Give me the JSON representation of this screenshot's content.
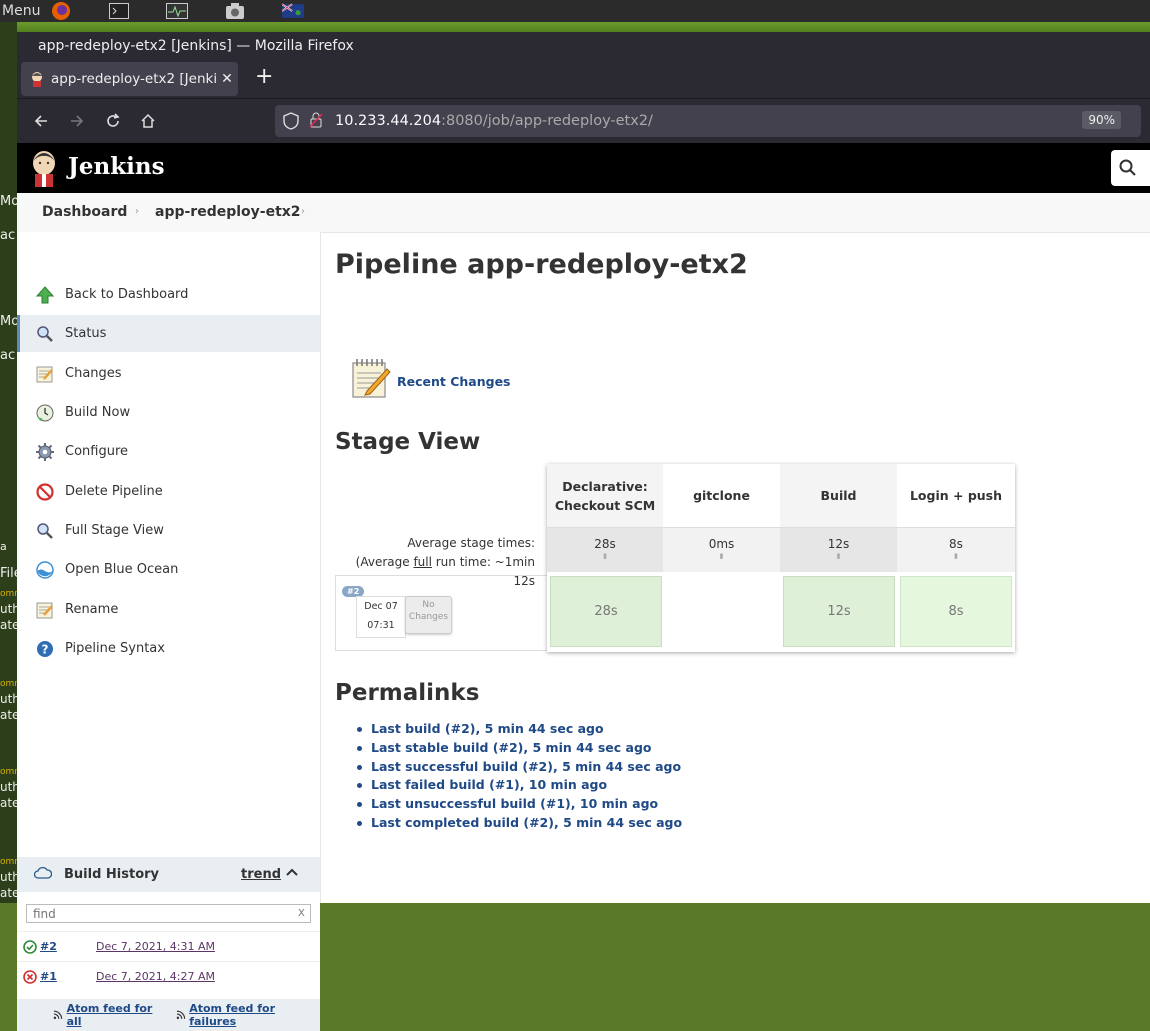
{
  "os_panel": {
    "menu_label": "Menu"
  },
  "desktop_fragments": [
    "Mo",
    "ac",
    "Mo",
    "ac",
    "a",
    "File",
    "omm",
    "uth",
    "ate",
    "omm",
    "uth",
    "ate",
    "omm",
    "uth",
    "ate",
    "omm",
    "uth",
    "ate"
  ],
  "window": {
    "title": "app-redeploy-etx2 [Jenkins] — Mozilla Firefox"
  },
  "tab": {
    "title": "app-redeploy-etx2 [Jenki",
    "close": "✕"
  },
  "newtab": "+",
  "nav": {
    "url_host": "10.233.44.204",
    "url_rest": ":8080/job/app-redeploy-etx2/",
    "zoom": "90%"
  },
  "jenkins": {
    "title": "Jenkins"
  },
  "breadcrumb": {
    "dashboard": "Dashboard",
    "job": "app-redeploy-etx2",
    "sep": "›"
  },
  "sidebar": {
    "items": [
      {
        "label": "Back to Dashboard",
        "icon": "up-arrow-icon"
      },
      {
        "label": "Status",
        "icon": "search-icon"
      },
      {
        "label": "Changes",
        "icon": "notepad-icon"
      },
      {
        "label": "Build Now",
        "icon": "clock-icon"
      },
      {
        "label": "Configure",
        "icon": "gear-icon"
      },
      {
        "label": "Delete Pipeline",
        "icon": "no-entry-icon"
      },
      {
        "label": "Full Stage View",
        "icon": "search-icon"
      },
      {
        "label": "Open Blue Ocean",
        "icon": "blue-ocean-icon"
      },
      {
        "label": "Rename",
        "icon": "notepad-icon"
      },
      {
        "label": "Pipeline Syntax",
        "icon": "help-icon"
      }
    ]
  },
  "build_history": {
    "title": "Build History",
    "trend": "trend",
    "search_placeholder": "find",
    "clear": "x",
    "builds": [
      {
        "number": "#2",
        "date": "Dec 7, 2021, 4:31 AM",
        "status": "success"
      },
      {
        "number": "#1",
        "date": "Dec 7, 2021, 4:27 AM",
        "status": "failed"
      }
    ],
    "feed_all": "Atom feed for all",
    "feed_failures": "Atom feed for failures"
  },
  "main": {
    "title": "Pipeline app-redeploy-etx2",
    "recent_changes": "Recent Changes",
    "stage_view_title": "Stage View",
    "avg_label": "Average stage times:",
    "avg_full_pre": "(Average ",
    "avg_full_link": "full",
    "avg_full_post": " run time: ~1min",
    "avg_full_time": "12s",
    "stages": [
      {
        "name_line1": "Declarative:",
        "name_line2": "Checkout SCM",
        "avg": "28s",
        "cell": "28s"
      },
      {
        "name_line1": "gitclone",
        "name_line2": "",
        "avg": "0ms",
        "cell": ""
      },
      {
        "name_line1": "Build",
        "name_line2": "",
        "avg": "12s",
        "cell": "12s"
      },
      {
        "name_line1": "Login + push",
        "name_line2": "",
        "avg": "8s",
        "cell": "8s"
      }
    ],
    "build_badge": "#2",
    "build_date": "Dec 07",
    "build_time": "07:31",
    "no_changes_1": "No",
    "no_changes_2": "Changes",
    "permalinks_title": "Permalinks",
    "permalinks": [
      "Last build (#2), 5 min 44 sec ago",
      "Last stable build (#2), 5 min 44 sec ago",
      "Last successful build (#2), 5 min 44 sec ago",
      "Last failed build (#1), 10 min ago",
      "Last unsuccessful build (#1), 10 min ago",
      "Last completed build (#2), 5 min 44 sec ago"
    ]
  }
}
